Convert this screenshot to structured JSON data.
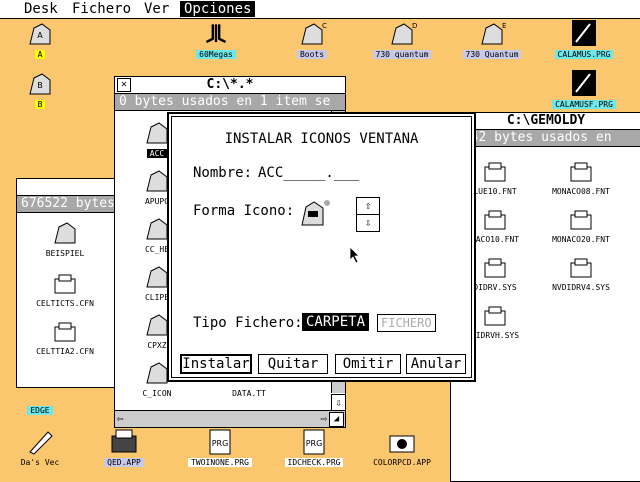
{
  "menu": {
    "desk": "Desk",
    "fichero": "Fichero",
    "ver": "Ver",
    "opciones": "Opciones"
  },
  "desktop_icons": {
    "a": "A",
    "b": "B",
    "atari": "60Megas",
    "c": "Boots",
    "c_letter": "C",
    "d": "730 quantum",
    "d_letter": "D",
    "e": "730 Quantum",
    "e_letter": "E",
    "calamus": "CALAMUS.PRG",
    "calamusf": "CALAMUSF.PRG",
    "edge": "EDGE",
    "dasvec": "Da's Vec",
    "qed": "QED.APP",
    "twoinone": "TWOINONE.PRG",
    "idcheck": "IDCHECK.PRG",
    "colorpcd": "COLORPCD.APP"
  },
  "win_left": {
    "info": "676522 bytes",
    "items": [
      "BEISPIEL",
      "CELTICTS.CFN",
      "CELTTIA2.CFN"
    ]
  },
  "win_mid": {
    "title": "C:\\*.*",
    "info": "0 bytes usados en 1 item se",
    "items": [
      "ACC",
      "APUPO",
      "CC_HE",
      "CLIPE",
      "CPXZ",
      "C_ICON",
      "DATA.TT"
    ]
  },
  "win_right": {
    "title": "C:\\GEMOLDY",
    "info": "8042 bytes usados en",
    "items": [
      "LUE10.FNT",
      "MONACO08.FNT",
      "NACO10.FNT",
      "MONACO20.FNT",
      "DIDRV.SYS",
      "NVDIDRV4.SYS",
      "DIDRVH.SYS"
    ]
  },
  "dialog": {
    "title": "INSTALAR ICONOS VENTANA",
    "nombre_label": "Nombre:",
    "nombre_value": "ACC_____.___",
    "forma_label": "Forma Icono:",
    "tipo_label": "Tipo Fichero:",
    "carpeta": "CARPETA",
    "fichero": "FICHERO",
    "buttons": {
      "instalar": "Instalar",
      "quitar": "Quitar",
      "omitir": "Omitir",
      "anular": "Anular"
    }
  },
  "colors": {
    "desktop": "#fbc76e",
    "label_yellow": "#ffff00",
    "label_cyan": "#6de8ea"
  }
}
